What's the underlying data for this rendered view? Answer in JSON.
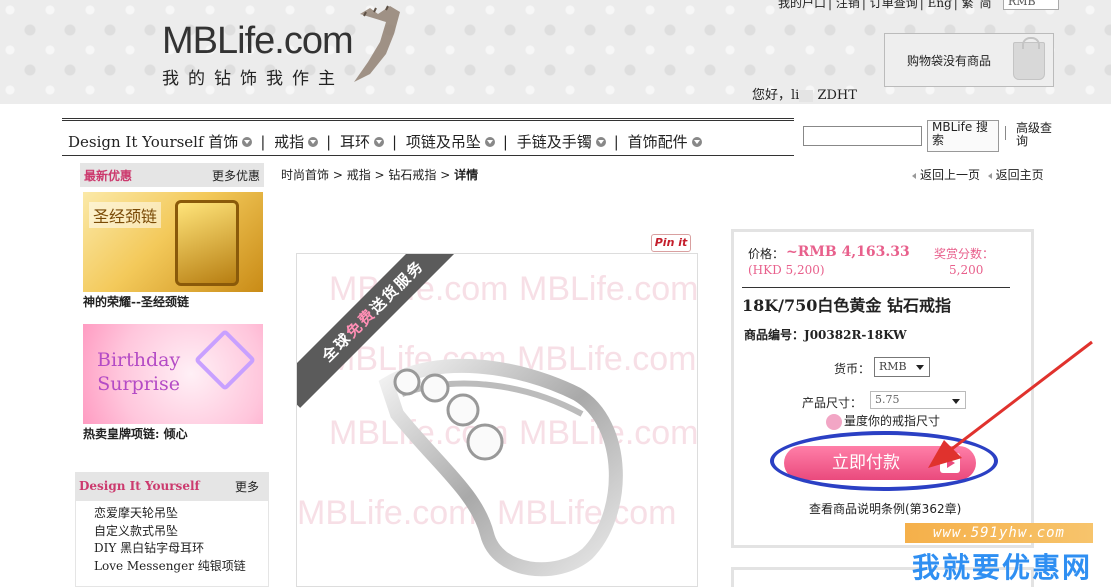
{
  "header": {
    "logo_text": "MBLife.com",
    "logo_slogan": "我的钻饰我作主",
    "top_links": [
      "我的户口",
      "注销",
      "订单查询",
      "Eng",
      "繁",
      "简"
    ],
    "currency_select": "RMB",
    "cart_text": "购物袋没有商品",
    "greeting_prefix": "您好，",
    "greeting_user": "li",
    "greeting_suffix": " ZDHT"
  },
  "nav": {
    "items": [
      "Design It Yourself 首饰",
      "戒指",
      "耳环",
      "项链及吊坠",
      "手链及手镯",
      "首饰配件"
    ],
    "search_button": "MBLife 搜索",
    "advanced_search": "高级查询"
  },
  "sidebar": {
    "deals_title": "最新优惠",
    "deals_more": "更多优惠",
    "promo1_badge": "圣经颈链",
    "promo1_caption": "神的荣耀--圣经颈链",
    "promo2_text1": "Birthday",
    "promo2_text2": "Surprise",
    "promo2_caption": "热卖皇牌项链: 倾心",
    "diy_title": "Design It Yourself",
    "diy_more": "更多",
    "diy_items": [
      "恋爱摩天轮吊坠",
      "自定义款式吊坠",
      "DIY 黑白钻字母耳环",
      "Love Messenger 纯银项链"
    ]
  },
  "breadcrumb": {
    "items": [
      "时尚首饰",
      "戒指",
      "钻石戒指"
    ],
    "current": "详情",
    "back_prev": "返回上一页",
    "back_home": "返回主页"
  },
  "product": {
    "pinit": "Pin it",
    "ribbon_pre": "全球",
    "ribbon_highlight": "免费",
    "ribbon_post": "送货服务",
    "watermark": "MBLife.com",
    "price_label": "价格：",
    "price_value": "~RMB 4,163.33",
    "price_hkd": "(HKD 5,200)",
    "reward_label": "奖赏分数：",
    "reward_value": "5,200",
    "name": "18K/750白色黄金 钻石戒指",
    "code_label": "商品编号：",
    "code_value": "J00382R-18KW",
    "currency_label": "货币：",
    "currency_value": "RMB",
    "size_label": "产品尺寸：",
    "size_value": "5.75",
    "measure_text": "量度你的戒指尺寸",
    "buy_button": "立即付款",
    "terms_text": "查看商品说明条例(第362章)"
  },
  "watermark_site": {
    "url": "www.591yhw.com",
    "name": "我就要优惠网"
  },
  "colors": {
    "accent_pink": "#e8608c",
    "annotation_blue": "#2b40c4",
    "annotation_red": "#e0322d"
  }
}
